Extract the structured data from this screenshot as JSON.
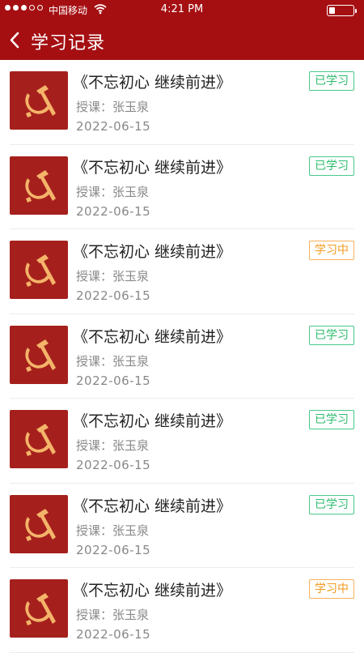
{
  "status_bar": {
    "carrier": "中国移动",
    "time": "4:21 PM",
    "battery_level": 0.22
  },
  "nav": {
    "title": "学习记录"
  },
  "records": [
    {
      "title": "《不忘初心   继续前进》",
      "teacher": "授课：张玉泉",
      "date": "2022-06-15",
      "status": "已学习",
      "status_type": "done"
    },
    {
      "title": "《不忘初心   继续前进》",
      "teacher": "授课：张玉泉",
      "date": "2022-06-15",
      "status": "已学习",
      "status_type": "done"
    },
    {
      "title": "《不忘初心   继续前进》",
      "teacher": "授课：张玉泉",
      "date": "2022-06-15",
      "status": "学习中",
      "status_type": "progress"
    },
    {
      "title": "《不忘初心   继续前进》",
      "teacher": "授课：张玉泉",
      "date": "2022-06-15",
      "status": "已学习",
      "status_type": "done"
    },
    {
      "title": "《不忘初心   继续前进》",
      "teacher": "授课：张玉泉",
      "date": "2022-06-15",
      "status": "已学习",
      "status_type": "done"
    },
    {
      "title": "《不忘初心   继续前进》",
      "teacher": "授课：张玉泉",
      "date": "2022-06-15",
      "status": "已学习",
      "status_type": "done"
    },
    {
      "title": "《不忘初心   继续前进》",
      "teacher": "授课：张玉泉",
      "date": "2022-06-15",
      "status": "学习中",
      "status_type": "progress"
    }
  ],
  "icons": {
    "back": "chevron-left-icon",
    "thumbnail": "hammer-sickle-icon",
    "wifi": "wifi-icon",
    "battery": "battery-icon"
  },
  "colors": {
    "header": "#a50f12",
    "thumb_bg": "#a5201c",
    "emblem": "#f4b46a",
    "done": "#2ebc6e",
    "progress": "#f39a1e"
  }
}
